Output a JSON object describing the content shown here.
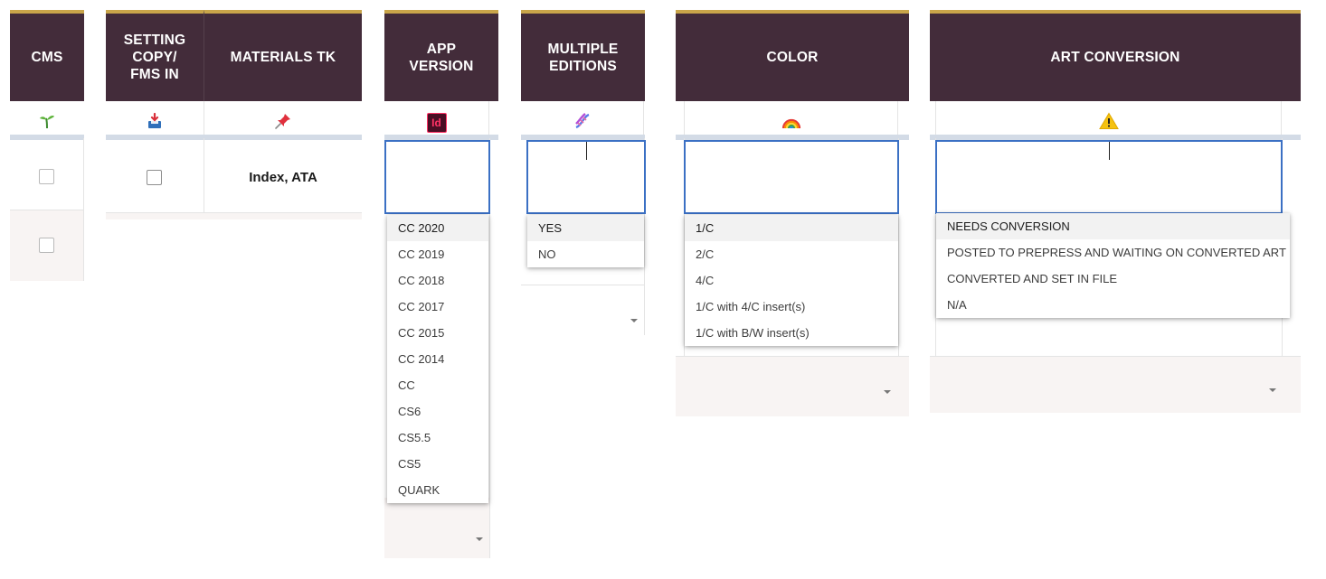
{
  "columns": {
    "cms": {
      "header": "CMS"
    },
    "setting_copy": {
      "header": "SETTING COPY/ FMS IN"
    },
    "materials_tk": {
      "header": "MATERIALS TK",
      "cell_value": "Index, ATA"
    },
    "app_version": {
      "header": "APP VERSION"
    },
    "multiple_editions": {
      "header": "MULTIPLE EDITIONS"
    },
    "color": {
      "header": "COLOR"
    },
    "art_conversion": {
      "header": "ART CONVERSION"
    }
  },
  "icons": {
    "cms": "seedling-icon",
    "setting_copy": "inbox-tray-icon",
    "materials_tk": "pushpin-icon",
    "app_version": "indesign-app-icon",
    "multiple_editions": "dna-icon",
    "color": "rainbow-icon",
    "art_conversion": "warning-icon"
  },
  "dropdowns": {
    "app_version": {
      "options": [
        "CC 2020",
        "CC 2019",
        "CC 2018",
        "CC 2017",
        "CC 2015",
        "CC 2014",
        "CC",
        "CS6",
        "CS5.5",
        "CS5",
        "QUARK"
      ],
      "highlighted": "CC 2020"
    },
    "multiple_editions": {
      "options": [
        "YES",
        "NO"
      ],
      "highlighted": "YES"
    },
    "color": {
      "options": [
        "1/C",
        "2/C",
        "4/C",
        "1/C with 4/C insert(s)",
        "1/C with B/W insert(s)"
      ],
      "highlighted": "1/C"
    },
    "art_conversion": {
      "options": [
        "NEEDS CONVERSION",
        "POSTED TO PREPRESS AND WAITING ON CONVERTED ART",
        "CONVERTED AND SET IN FILE",
        "N/A"
      ],
      "highlighted": "NEEDS CONVERSION"
    }
  },
  "colors": {
    "header_bg": "#432c3a",
    "header_top_accent": "#c9a54a",
    "edit_border": "#3b70c4",
    "band": "#d3dbe6",
    "alt_row": "#f8f4f3"
  }
}
